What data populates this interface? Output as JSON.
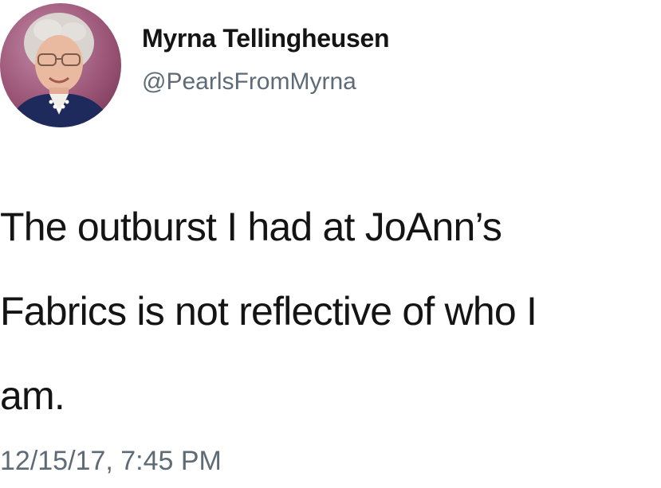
{
  "author": {
    "display_name": "Myrna Tellingheusen",
    "handle": "@PearlsFromMyrna",
    "avatar": "profile-photo"
  },
  "tweet": {
    "lines": [
      "The outburst I had at JoAnn’s",
      "Fabrics is not reflective of who I",
      "am."
    ],
    "timestamp": "12/15/17, 7:45 PM"
  }
}
